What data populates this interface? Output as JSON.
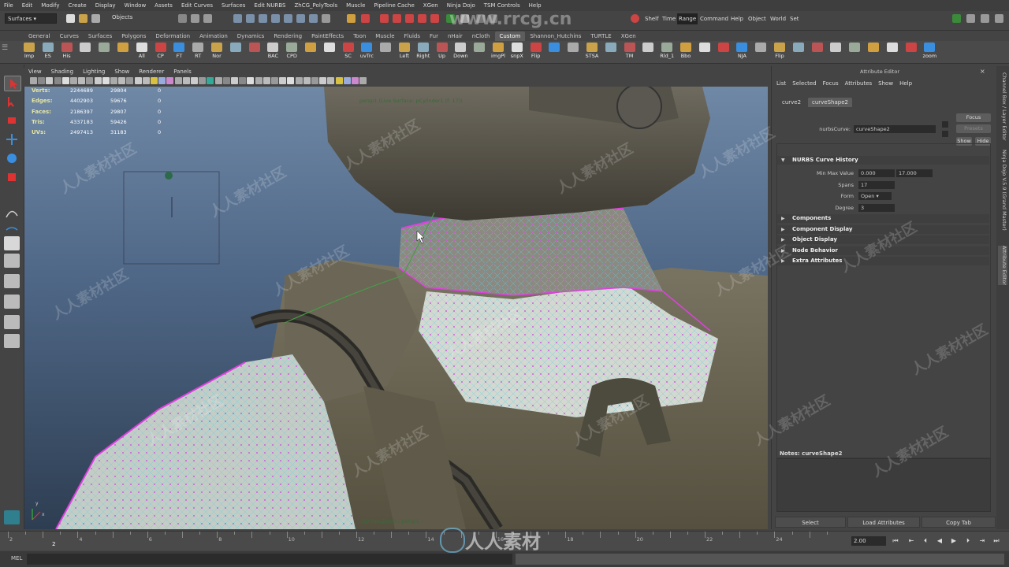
{
  "menubar": [
    "File",
    "Edit",
    "Modify",
    "Create",
    "Display",
    "Window",
    "Assets",
    "Edit Curves",
    "Surfaces",
    "Edit NURBS",
    "ZhCG_PolyTools",
    "Muscle",
    "Pipeline Cache",
    "XGen",
    "Ninja Dojo",
    "TSM Controls",
    "Help"
  ],
  "status": {
    "mode": "Surfaces",
    "objects_label": "Objects",
    "right_buttons": [
      "Shelf",
      "Time",
      "Range",
      "Command",
      "Help",
      "Object",
      "World",
      "Set"
    ],
    "active_right": "Range"
  },
  "shelf_tabs": [
    "General",
    "Curves",
    "Surfaces",
    "Polygons",
    "Deformation",
    "Animation",
    "Dynamics",
    "Rendering",
    "PaintEffects",
    "Toon",
    "Muscle",
    "Fluids",
    "Fur",
    "nHair",
    "nCloth",
    "Custom",
    "Shannon_Hutchins",
    "TURTLE",
    "XGen"
  ],
  "active_shelf_tab": "Custom",
  "shelf_items": [
    "Imp",
    "ES",
    "His",
    "",
    "",
    "",
    "All",
    "CP",
    "FT",
    "RT",
    "Nor",
    "",
    "",
    "BAC",
    "CPD",
    "",
    "",
    "SC",
    "uvTrc",
    "",
    "Left",
    "Right",
    "Up",
    "Down",
    "",
    "imgPl",
    "snpX",
    "Flip",
    "",
    "",
    "STSA",
    "",
    "TM",
    "",
    "Rld_1",
    "Bbo",
    "",
    "",
    "NJA",
    "",
    "Flip",
    "",
    "",
    "",
    "",
    "",
    "",
    "",
    "zoom"
  ],
  "panel_menu": [
    "View",
    "Shading",
    "Lighting",
    "Show",
    "Renderer",
    "Panels"
  ],
  "hud": {
    "rows": [
      {
        "label": "Verts:",
        "v1": "2244689",
        "v2": "29804",
        "v3": "0"
      },
      {
        "label": "Edges:",
        "v1": "4402903",
        "v2": "59676",
        "v3": "0"
      },
      {
        "label": "Faces:",
        "v1": "2186397",
        "v2": "29807",
        "v3": "0"
      },
      {
        "label": "Tris:",
        "v1": "4337183",
        "v2": "59426",
        "v3": "0"
      },
      {
        "label": "UVs:",
        "v1": "2497413",
        "v2": "31183",
        "v3": "0"
      }
    ],
    "camera_label": "persp1 (Live Surface: pCylinder1 (f: 17))",
    "bottom_label": "3D Pan/Zoom : persp1",
    "axis_y": "y",
    "axis_x": "x"
  },
  "attr_editor": {
    "title": "Attribute Editor",
    "menu": [
      "List",
      "Selected",
      "Focus",
      "Attributes",
      "Show",
      "Help"
    ],
    "tabs": [
      "curve2",
      "curveShape2"
    ],
    "active_tab": "curveShape2",
    "node_label": "nurbsCurve:",
    "node_value": "curveShape2",
    "buttons": {
      "focus": "Focus",
      "presets": "Presets",
      "show": "Show",
      "hide": "Hide"
    },
    "history_section": "NURBS Curve History",
    "min_max_label": "Min Max Value",
    "min_value": "0.000",
    "max_value": "17.000",
    "spans_label": "Spans",
    "spans_value": "17",
    "form_label": "Form",
    "form_value": "Open",
    "degree_label": "Degree",
    "degree_value": "3",
    "sections": [
      "Components",
      "Component Display",
      "Object Display",
      "Node Behavior",
      "Extra Attributes"
    ],
    "notes_label": "Notes:  curveShape2",
    "bottom_buttons": [
      "Select",
      "Load Attributes",
      "Copy Tab"
    ]
  },
  "side_tabs": [
    "Channel Box / Layer Editor",
    "Ninja Dojo V.5.9 (Grand Master)",
    "Attribute Editor"
  ],
  "timeline": {
    "ticks": [
      "2",
      "4",
      "6",
      "8",
      "10",
      "12",
      "14",
      "16",
      "18",
      "20",
      "22",
      "24"
    ],
    "current_frame": "2",
    "range_end": "2.00"
  },
  "cmdline": {
    "label": "MEL"
  },
  "watermark": {
    "top": "www.rrcg.cn",
    "bottom": "人人素材",
    "tile": "人人素材社区"
  },
  "colors": {
    "wire_pink": "#e040e0",
    "wire_cyan": "#60d0e0",
    "vest": "#6b6655",
    "sky_top": "#6f88a6"
  }
}
